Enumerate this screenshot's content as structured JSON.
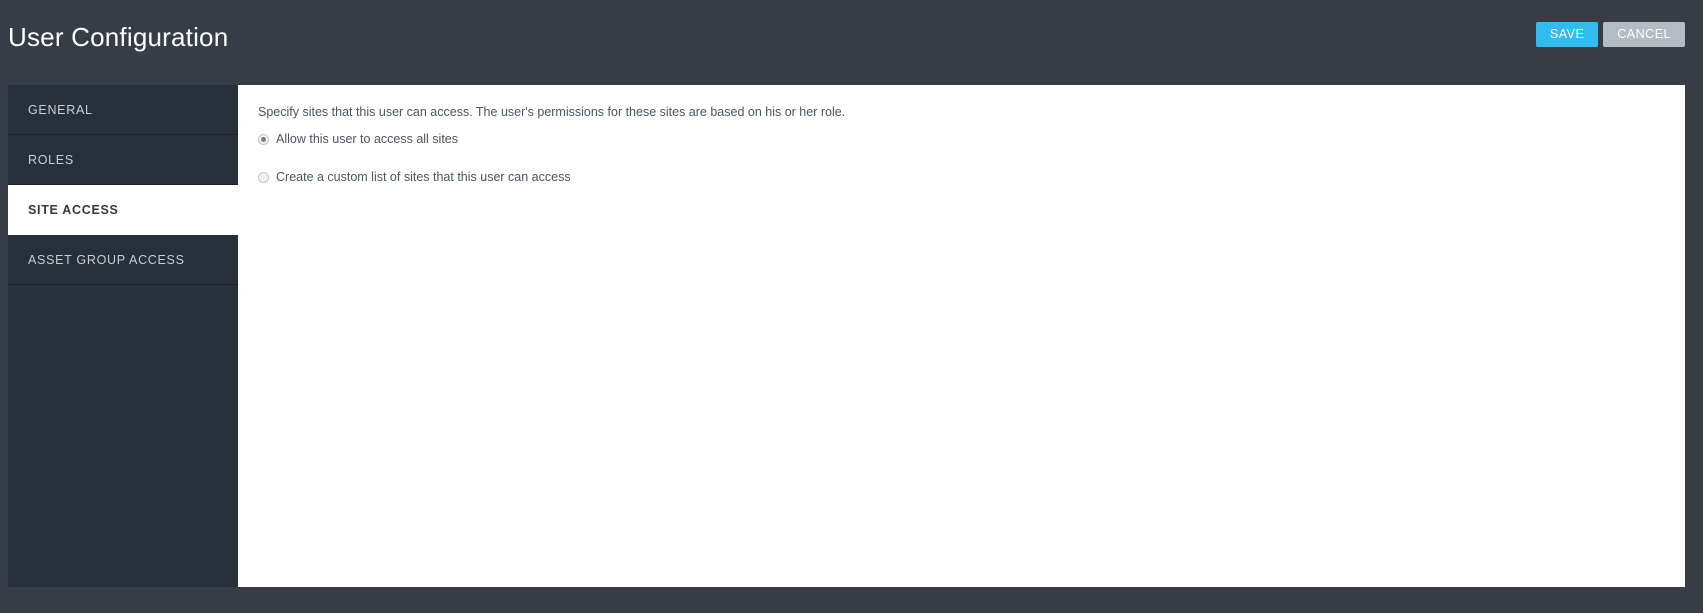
{
  "header": {
    "title": "User Configuration",
    "save_label": "SAVE",
    "cancel_label": "CANCEL",
    "save_color": "#33baf1",
    "cancel_color": "#b3bcc2",
    "background": "#363d46"
  },
  "sidebar": {
    "background": "#262f3a",
    "active_background": "#ffffff",
    "items": [
      {
        "label": "GENERAL",
        "active": false
      },
      {
        "label": "ROLES",
        "active": false
      },
      {
        "label": "SITE ACCESS",
        "active": true
      },
      {
        "label": "ASSET GROUP ACCESS",
        "active": false
      }
    ]
  },
  "main": {
    "description": "Specify sites that this user can access. The user's permissions for these sites are based on his or her role.",
    "options": [
      {
        "label": "Allow this user to access all sites",
        "selected": true
      },
      {
        "label": "Create a custom list of sites that this user can access",
        "selected": false
      }
    ]
  }
}
